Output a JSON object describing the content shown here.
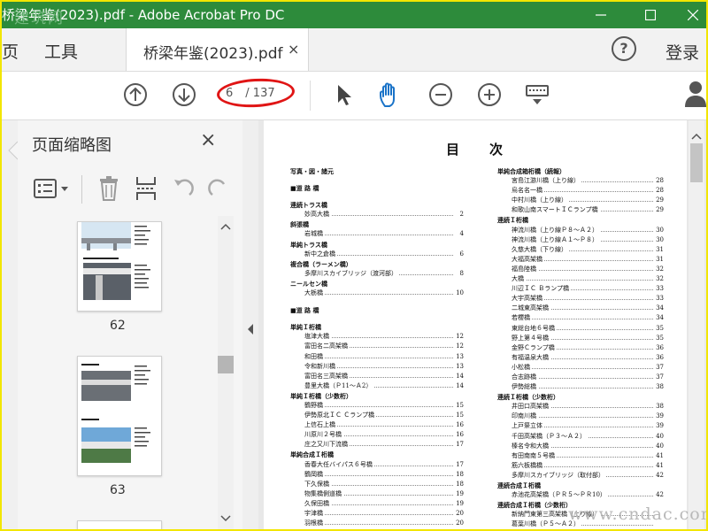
{
  "window": {
    "title": "桥梁年鉴(2023).pdf - Adobe Acrobat Pro DC",
    "watermark": "建筑网"
  },
  "menubar": {
    "home_partial": "页",
    "tools": "工具",
    "doc_tab": "桥梁年鉴(2023).pdf",
    "close_tab": "×",
    "help": "?",
    "login": "登录"
  },
  "toolbar": {
    "page_current": "6",
    "page_total": "/ 137"
  },
  "sidebar": {
    "title": "页面缩略图",
    "close": "×",
    "page_labels": [
      "62",
      "63"
    ]
  },
  "document": {
    "title": "目次",
    "left_column": [
      {
        "t": "写真・図・諸元",
        "p": "",
        "kind": "h"
      },
      {
        "t": "",
        "p": "",
        "kind": "gap"
      },
      {
        "t": "■道 路 橋",
        "p": "",
        "kind": "h"
      },
      {
        "t": "",
        "p": "",
        "kind": "gap"
      },
      {
        "t": "連続トラス橋",
        "p": "",
        "kind": "h"
      },
      {
        "t": "妙高大橋",
        "p": "2",
        "kind": "e"
      },
      {
        "t": "斜張橋",
        "p": "",
        "kind": "h"
      },
      {
        "t": "岩城橋",
        "p": "4",
        "kind": "e"
      },
      {
        "t": "単純トラス橋",
        "p": "",
        "kind": "h"
      },
      {
        "t": "新中之倉橋",
        "p": "6",
        "kind": "e"
      },
      {
        "t": "複合橋（ラーメン橋）",
        "p": "",
        "kind": "h"
      },
      {
        "t": "多摩川スカイブリッジ（渡河部）",
        "p": "8",
        "kind": "e"
      },
      {
        "t": "ニールセン橋",
        "p": "",
        "kind": "h"
      },
      {
        "t": "大栃橋",
        "p": "10",
        "kind": "e"
      },
      {
        "t": "",
        "p": "",
        "kind": "gap"
      },
      {
        "t": "■道 路 橋",
        "p": "",
        "kind": "h"
      },
      {
        "t": "",
        "p": "",
        "kind": "gap"
      },
      {
        "t": "単純Ｉ桁橋",
        "p": "",
        "kind": "h"
      },
      {
        "t": "塩津大橋",
        "p": "12",
        "kind": "e"
      },
      {
        "t": "富田名二高架橋",
        "p": "12",
        "kind": "e"
      },
      {
        "t": "和田橋",
        "p": "13",
        "kind": "e"
      },
      {
        "t": "令和新川橋",
        "p": "13",
        "kind": "e"
      },
      {
        "t": "富田名三高架橋",
        "p": "14",
        "kind": "e"
      },
      {
        "t": "豊里大橋（Ｐ11～Ａ2）",
        "p": "14",
        "kind": "e"
      },
      {
        "t": "単純Ｉ桁橋（少数桁）",
        "p": "",
        "kind": "h"
      },
      {
        "t": "鶴野橋",
        "p": "15",
        "kind": "e"
      },
      {
        "t": "伊勢原北ＩＣ Ｃランプ橋",
        "p": "15",
        "kind": "e"
      },
      {
        "t": "上信石上橋",
        "p": "16",
        "kind": "e"
      },
      {
        "t": "川原川２号橋",
        "p": "16",
        "kind": "e"
      },
      {
        "t": "庄之又川下流橋",
        "p": "17",
        "kind": "e"
      },
      {
        "t": "単純合成Ｉ桁橋",
        "p": "",
        "kind": "h"
      },
      {
        "t": "香春大任バイパス６号橋",
        "p": "17",
        "kind": "e"
      },
      {
        "t": "鶴岡橋",
        "p": "18",
        "kind": "e"
      },
      {
        "t": "下久保橋",
        "p": "18",
        "kind": "e"
      },
      {
        "t": "物集橋側道橋",
        "p": "19",
        "kind": "e"
      },
      {
        "t": "久保田橋",
        "p": "19",
        "kind": "e"
      },
      {
        "t": "宇津橋",
        "p": "20",
        "kind": "e"
      },
      {
        "t": "羽根橋",
        "p": "20",
        "kind": "e"
      }
    ],
    "right_column": [
      {
        "t": "単純合成箱桁橋（続報）",
        "p": "",
        "kind": "h"
      },
      {
        "t": "宮島江游川橋（上り線）",
        "p": "28",
        "kind": "e"
      },
      {
        "t": "烏名名一橋",
        "p": "28",
        "kind": "e"
      },
      {
        "t": "中村川橋（上り線）",
        "p": "29",
        "kind": "e"
      },
      {
        "t": "和歌山南スマートＩＣランプ橋",
        "p": "29",
        "kind": "e"
      },
      {
        "t": "連続Ｉ桁橋",
        "p": "",
        "kind": "h"
      },
      {
        "t": "神流川橋（上り線Ｐ８～Ａ２）",
        "p": "30",
        "kind": "e"
      },
      {
        "t": "神流川橋（上り線Ａ１～Ｐ８）",
        "p": "30",
        "kind": "e"
      },
      {
        "t": "久慈大橋（下り線）",
        "p": "31",
        "kind": "e"
      },
      {
        "t": "大福高架橋",
        "p": "31",
        "kind": "e"
      },
      {
        "t": "福島陸橋",
        "p": "32",
        "kind": "e"
      },
      {
        "t": "大橋",
        "p": "32",
        "kind": "e"
      },
      {
        "t": "川辺ＩＣ Ｂランプ橋",
        "p": "33",
        "kind": "e"
      },
      {
        "t": "大宇高架橋",
        "p": "33",
        "kind": "e"
      },
      {
        "t": "二城東高架橋",
        "p": "34",
        "kind": "e"
      },
      {
        "t": "若櫻橋",
        "p": "34",
        "kind": "e"
      },
      {
        "t": "東総台地６号橋",
        "p": "35",
        "kind": "e"
      },
      {
        "t": "野上第４号橋",
        "p": "35",
        "kind": "e"
      },
      {
        "t": "金野Ｃランプ橋",
        "p": "36",
        "kind": "e"
      },
      {
        "t": "有福温泉大橋",
        "p": "36",
        "kind": "e"
      },
      {
        "t": "小松橋",
        "p": "37",
        "kind": "e"
      },
      {
        "t": "合志跡橋",
        "p": "37",
        "kind": "e"
      },
      {
        "t": "伊勢総橋",
        "p": "38",
        "kind": "e"
      },
      {
        "t": "連続Ｉ桁橋（少数桁）",
        "p": "",
        "kind": "h"
      },
      {
        "t": "井田口高架橋",
        "p": "38",
        "kind": "e"
      },
      {
        "t": "印南川橋",
        "p": "39",
        "kind": "e"
      },
      {
        "t": "上戸祭立体",
        "p": "39",
        "kind": "e"
      },
      {
        "t": "千田高架橋（Ｐ３～Ａ２）",
        "p": "40",
        "kind": "e"
      },
      {
        "t": "榛名令和大橋",
        "p": "40",
        "kind": "e"
      },
      {
        "t": "有田南南５号橋",
        "p": "41",
        "kind": "e"
      },
      {
        "t": "筋六板橋橋",
        "p": "41",
        "kind": "e"
      },
      {
        "t": "多摩川スカイブリッジ（取付部）",
        "p": "42",
        "kind": "e"
      },
      {
        "t": "連続合成Ｉ桁橋",
        "p": "",
        "kind": "h"
      },
      {
        "t": "赤池花高架橋（ＰＲ５～ＰＲ10）",
        "p": "42",
        "kind": "e"
      },
      {
        "t": "連続合成Ｉ桁橋（少数桁）",
        "p": "",
        "kind": "h"
      },
      {
        "t": "新納門東第三高架橋（上り線）",
        "p": "",
        "kind": "e"
      },
      {
        "t": "葛葉川橋（Ｐ５～Ａ２）",
        "p": "",
        "kind": "e"
      },
      {
        "t": "江戸川橋",
        "p": "",
        "kind": "e"
      }
    ]
  },
  "site_watermark": "www.cndac.com",
  "colors": {
    "titlebar": "#2d8b3b",
    "accent_blue": "#1a73c8",
    "annotation_red": "#e01515"
  }
}
